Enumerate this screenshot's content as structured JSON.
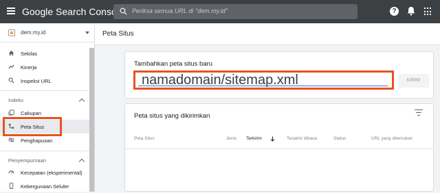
{
  "topbar": {
    "title": "Google Search Console",
    "search_placeholder": "Periksa semua URL di \"dem.my.id\""
  },
  "sidebar": {
    "property": "dem.my.id",
    "top_items": [
      {
        "label": "Sekilas",
        "icon": "home-icon"
      },
      {
        "label": "Kinerja",
        "icon": "trending-icon"
      },
      {
        "label": "Inspeksi URL",
        "icon": "search-icon"
      }
    ],
    "index_section": "Indeks",
    "index_items": [
      {
        "label": "Cakupan",
        "icon": "copy-icon"
      },
      {
        "label": "Peta Situs",
        "icon": "sitemap-icon",
        "active": true
      },
      {
        "label": "Penghapusan",
        "icon": "visibility-off-icon"
      }
    ],
    "enhance_section": "Penyempurnaan",
    "enhance_items": [
      {
        "label": "Kecepatan (eksperimental)",
        "icon": "speed-icon"
      },
      {
        "label": "Kebergunaan Seluler",
        "icon": "phone-icon"
      }
    ]
  },
  "main": {
    "page_title": "Peta Situs",
    "add_card": {
      "title": "Tambahkan peta situs baru",
      "url_value": "namadomain/sitemap.xml",
      "submit_label": "KIRIM"
    },
    "submitted_card": {
      "title": "Peta situs yang dikirimkan",
      "columns": [
        "Peta Situs",
        "Jenis",
        "Terkirim",
        "Terakhir dibaca",
        "Status",
        "URL yang ditemukan"
      ]
    }
  },
  "colors": {
    "topbar": "#3c4043",
    "highlight": "#e8521e",
    "input_underline": "#3d6bd9"
  }
}
